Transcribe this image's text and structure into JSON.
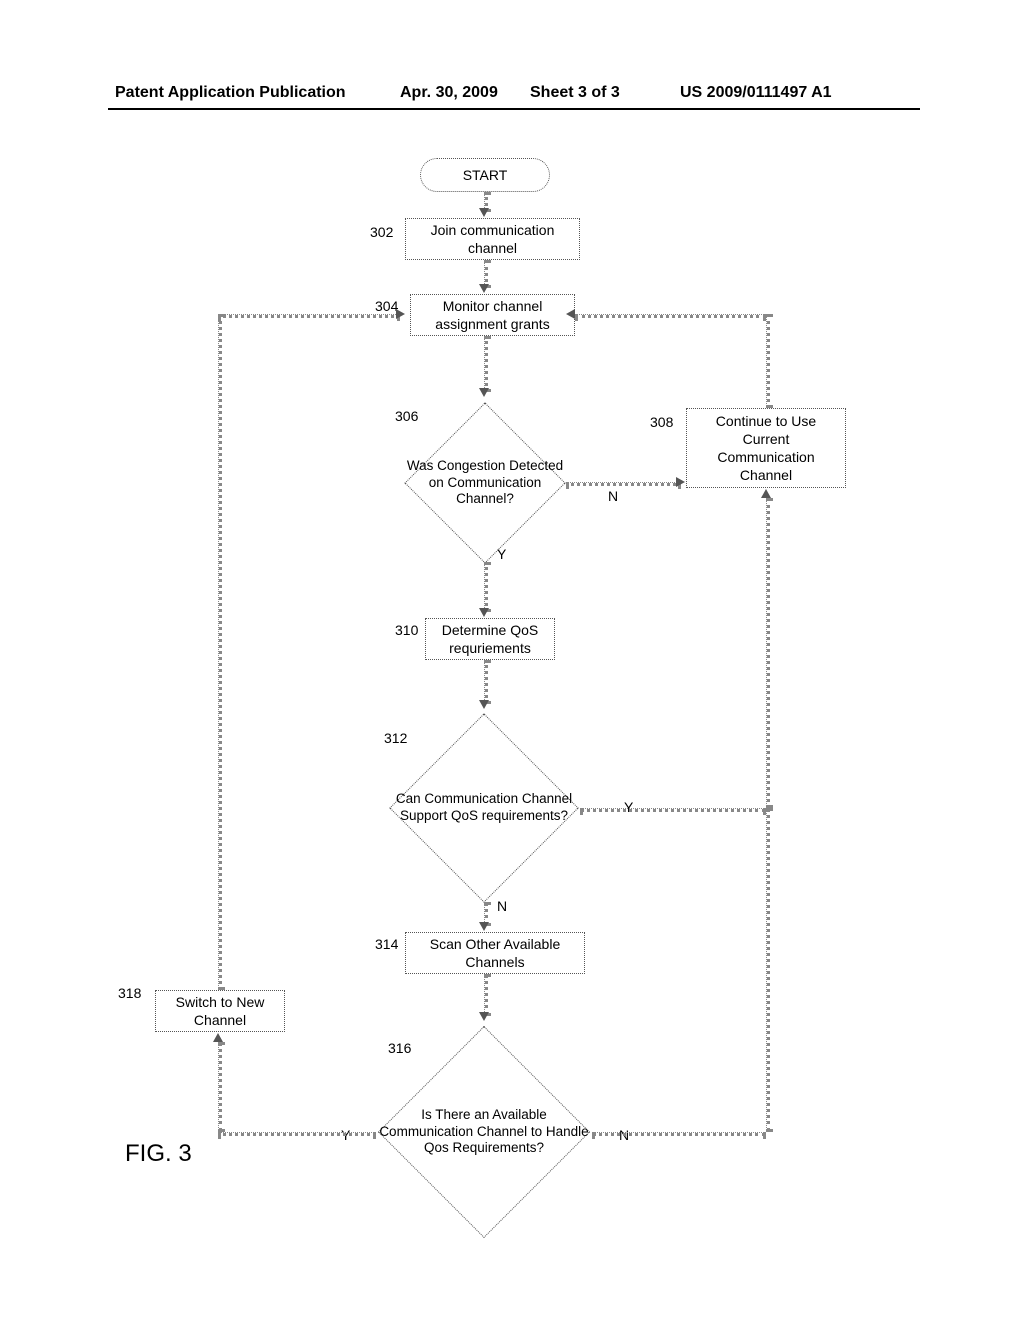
{
  "header": {
    "publication": "Patent Application Publication",
    "date": "Apr. 30, 2009",
    "sheet": "Sheet 3 of 3",
    "pubnum": "US 2009/0111497 A1"
  },
  "figure_label": "FIG. 3",
  "nodes": {
    "start": {
      "label": "START"
    },
    "n302": {
      "ref": "302",
      "text": "Join communication channel"
    },
    "n304": {
      "ref": "304",
      "text": "Monitor channel assignment grants"
    },
    "n306": {
      "ref": "306",
      "text": "Was Congestion Detected on Communication Channel?"
    },
    "n308": {
      "ref": "308",
      "text": "Continue to Use Current Communication Channel"
    },
    "n310": {
      "ref": "310",
      "text": "Determine QoS requriements"
    },
    "n312": {
      "ref": "312",
      "text": "Can Communication Channel Support QoS requirements?"
    },
    "n314": {
      "ref": "314",
      "text": "Scan Other Available Channels"
    },
    "n316": {
      "ref": "316",
      "text": "Is There an Available Communication Channel to Handle Qos Requirements?"
    },
    "n318": {
      "ref": "318",
      "text": "Switch to New Channel"
    }
  },
  "edge_labels": {
    "n306_yes": "Y",
    "n306_no": "N",
    "n312_yes": "Y",
    "n312_no": "N",
    "n316_yes": "Y",
    "n316_no": "N"
  }
}
